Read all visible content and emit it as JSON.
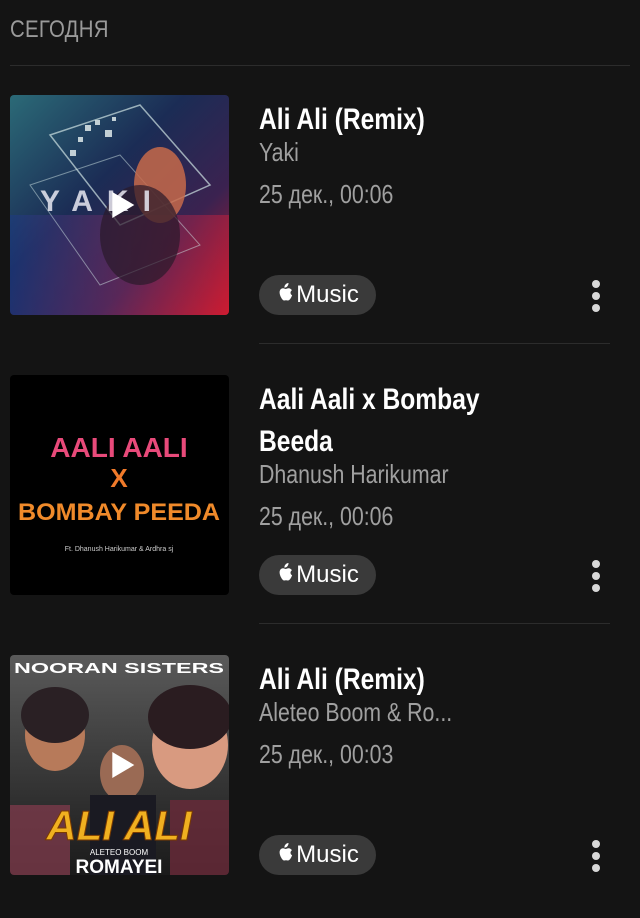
{
  "section": {
    "title": "СЕГОДНЯ"
  },
  "badge_label": "Music",
  "items": [
    {
      "title": "Ali Ali (Remix)",
      "artist": "Yaki",
      "date": "25 дек., 00:06",
      "art": {
        "kind": "yaki",
        "text": "YAKI",
        "has_play": true
      }
    },
    {
      "title": "Aali Aali x Bombay Beeda",
      "artist": "Dhanush Harikumar",
      "date": "25 дек., 00:06",
      "art": {
        "kind": "bombay",
        "line1": "AALI AALI",
        "line2": "X",
        "line3": "BOMBAY PEEDA",
        "credit": "Ft. Dhanush Harikumar & Ardhra sj",
        "has_play": false
      }
    },
    {
      "title": "Ali Ali (Remix)",
      "artist": "Aleteo Boom & Ro...",
      "date": "25 дек., 00:03",
      "art": {
        "kind": "nooran",
        "top": "NOORAN SISTERS",
        "big": "ALI ALI",
        "small": "ALETEO BOOM",
        "bottom": "ROMAYEI",
        "has_play": true
      }
    }
  ],
  "colors": {
    "background": "#141414",
    "muted_text": "#a0a0a0",
    "badge_bg": "#3a3a3a"
  }
}
